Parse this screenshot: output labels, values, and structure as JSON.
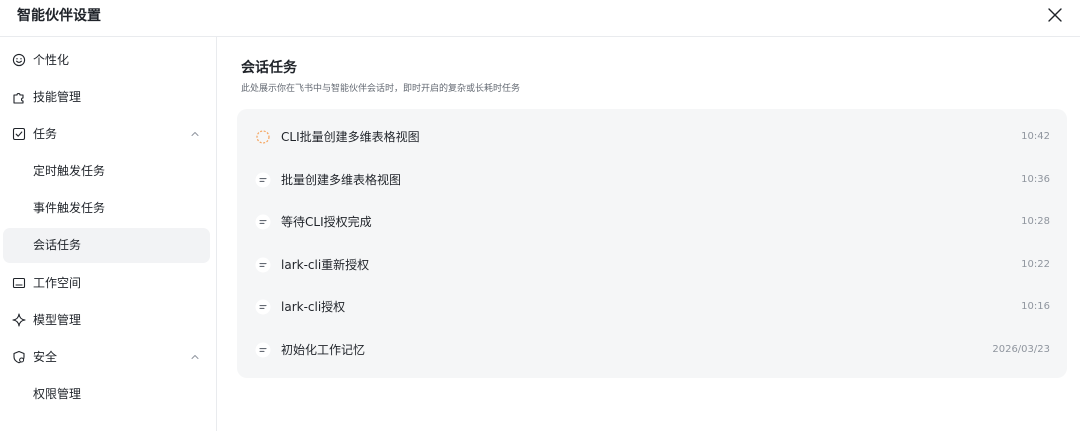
{
  "header": {
    "title": "智能伙伴设置"
  },
  "sidebar": {
    "items": [
      {
        "label": "个性化",
        "icon": "smile-icon"
      },
      {
        "label": "技能管理",
        "icon": "puzzle-icon"
      },
      {
        "label": "任务",
        "icon": "checkbox-icon",
        "expanded": true
      },
      {
        "label": "定时触发任务"
      },
      {
        "label": "事件触发任务"
      },
      {
        "label": "会话任务",
        "active": true
      },
      {
        "label": "工作空间",
        "icon": "folder-icon"
      },
      {
        "label": "模型管理",
        "icon": "sparkle-icon"
      },
      {
        "label": "安全",
        "icon": "shield-icon",
        "expanded": true
      },
      {
        "label": "权限管理"
      }
    ]
  },
  "main": {
    "title": "会话任务",
    "description": "此处展示你在飞书中与智能伙伴会话时，即时开启的复杂或长耗时任务",
    "tasks": [
      {
        "name": "CLI批量创建多维表格视图",
        "time": "10:42",
        "status": "in-progress",
        "icon": "loading-icon"
      },
      {
        "name": "批量创建多维表格视图",
        "time": "10:36",
        "status": "done",
        "icon": "list-icon"
      },
      {
        "name": "等待CLI授权完成",
        "time": "10:28",
        "status": "done",
        "icon": "list-icon"
      },
      {
        "name": "lark-cli重新授权",
        "time": "10:22",
        "status": "done",
        "icon": "list-icon"
      },
      {
        "name": "lark-cli授权",
        "time": "10:16",
        "status": "done",
        "icon": "list-icon"
      },
      {
        "name": "初始化工作记忆",
        "time": "2026/03/23",
        "status": "done",
        "icon": "list-icon"
      }
    ]
  },
  "colors": {
    "active_bg": "#f2f3f5",
    "panel_bg": "#f5f6f7",
    "loading": "#f5a35c",
    "text": "#1f2329",
    "muted": "#8f959e"
  }
}
